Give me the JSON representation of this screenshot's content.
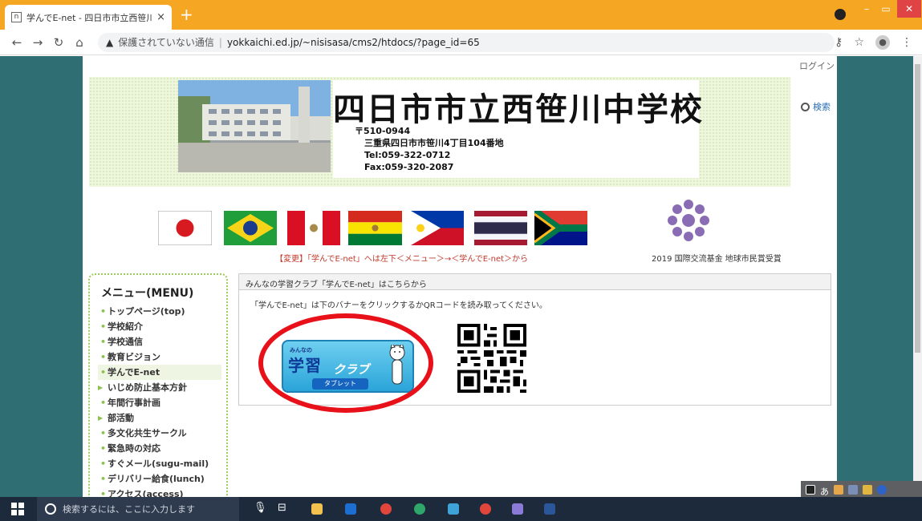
{
  "browser": {
    "tab_title": "学んでE-net - 四日市市立西笹川",
    "tab_close": "×",
    "new_tab": "+",
    "security_label": "保護されていない通信",
    "url": "yokkaichi.ed.jp/~nisisasa/cms2/htdocs/?page_id=65"
  },
  "page": {
    "login": "ログイン",
    "school_name": "四日市市立西笹川中学校",
    "postal": "〒510-0944",
    "address": "三重県四日市市笹川4丁目104番地",
    "tel": "Tel:059-322-0712",
    "fax": "Fax:059-320-2087",
    "search": "検索",
    "notice": "【変更】「学んでE-net」へは左下＜メニュー＞→＜学んでE-net＞から",
    "award": "2019 国際交流基金 地球市民賞受賞"
  },
  "menu": {
    "title": "メニュー(MENU)",
    "items": [
      "トップページ(top)",
      "学校紹介",
      "学校通信",
      "教育ビジョン",
      "学んでE-net",
      "いじめ防止基本方針",
      "年間行事計画",
      "部活動",
      "多文化共生サークル",
      "緊急時の対応",
      "すぐメール(sugu-mail)",
      "デリバリー給食(lunch)",
      "アクセス(access)"
    ]
  },
  "content": {
    "header": "みんなの学習クラブ「学んでE-net」はこちらから",
    "text": "「学んでE-net」は下のバナーをクリックするかQRコードを読み取ってください。",
    "banner_small": "みんなの",
    "banner_big": "学習",
    "banner_club": "クラブ",
    "banner_tablet": "タブレット"
  },
  "taskbar": {
    "search_placeholder": "検索するには、ここに入力します",
    "ime": "あ"
  },
  "colors": {
    "tab_bar": "#f5a623",
    "page_side": "#2f6e72",
    "menu_border": "#9ccc5a",
    "highlight_oval": "#e8111a",
    "taskbar": "#1c2a3c"
  }
}
